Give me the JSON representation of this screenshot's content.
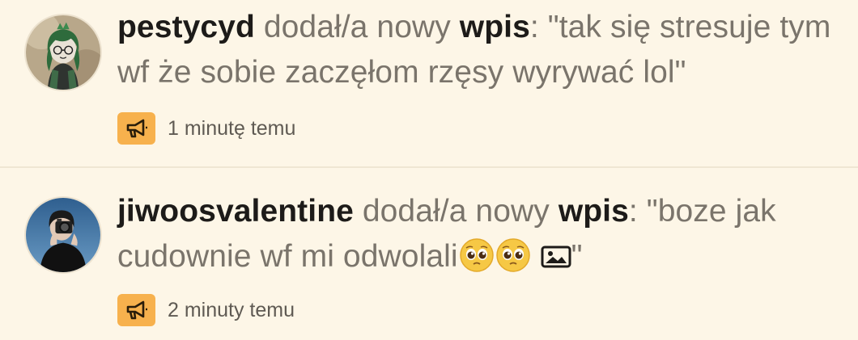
{
  "notifications": [
    {
      "username": "pestycyd",
      "action_text": " dodał/a nowy ",
      "object_type": "wpis",
      "colon": ": ",
      "quote": "\"tak się stresuje tym wf że sobie zaczęłom rzęsy wyrywać lol\"",
      "timestamp": "1 minutę temu",
      "avatar_icon": "green-haired-character-avatar",
      "type_icon": "megaphone-icon"
    },
    {
      "username": "jiwoosvalentine",
      "action_text": " dodał/a nowy ",
      "object_type": "wpis",
      "colon": ": ",
      "quote_open": "\"boze jak cudownie wf mi odwolali",
      "quote_close": "\"",
      "emojis": [
        "pleading-face-emoji",
        "pleading-face-emoji"
      ],
      "attachment_icon": "image-icon",
      "timestamp": "2 minuty temu",
      "avatar_icon": "person-with-camera-avatar",
      "type_icon": "megaphone-icon"
    }
  ],
  "colors": {
    "background": "#fdf6e7",
    "username": "#1d1b19",
    "body_text": "#7a746b",
    "badge": "#f7b14d",
    "badge_icon": "#2a1d0a"
  }
}
